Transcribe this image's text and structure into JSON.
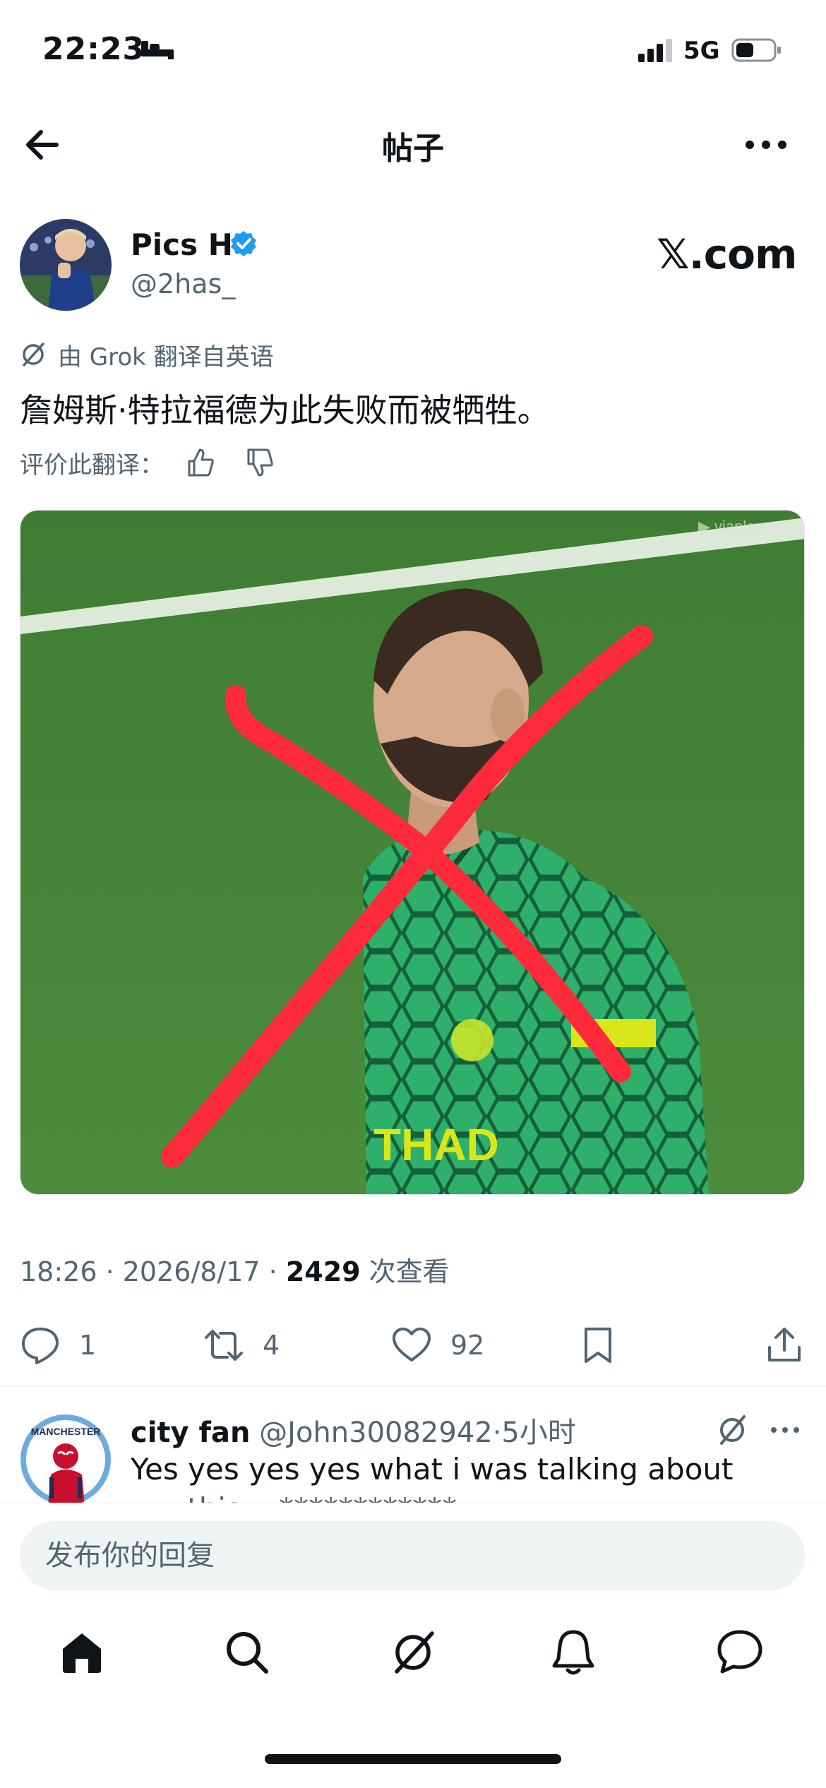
{
  "status_bar": {
    "time": "22:23",
    "network": "5G",
    "icons": [
      "bed-icon",
      "signal-icon",
      "battery-icon"
    ]
  },
  "header": {
    "title": "帖子",
    "back_icon": "back-arrow-icon",
    "more_icon": "more-icon"
  },
  "post": {
    "author_name": "Pics H",
    "author_handle": "@2has_",
    "verified": true,
    "source": "𝕏.com",
    "translation_note": "由 Grok 翻译自英语",
    "text": "詹姆斯·特拉福德为此失败而被牺牲。",
    "rate_label": "评价此翻译：",
    "meta_time": "18:26 · 2026/8/17 · ",
    "views": "2429",
    "views_suffix": " 次查看"
  },
  "actions": {
    "replies": "1",
    "reposts": "4",
    "likes": "92"
  },
  "reply": {
    "name": "city fan",
    "handle": "@John30082942",
    "time": "·5小时",
    "text": "Yes yes yes yes what i was talking about",
    "overflow": "... ..this... ************"
  },
  "compose": {
    "placeholder": "发布你的回复"
  },
  "tabs": [
    "home-icon",
    "search-icon",
    "grok-icon",
    "notifications-icon",
    "messages-icon"
  ],
  "colors": {
    "text": "#0f1419",
    "muted": "#536471",
    "verified_blue": "#1d9bf0",
    "x_mark_red": "#ff2a3a",
    "input_bg": "#eff3f4"
  }
}
